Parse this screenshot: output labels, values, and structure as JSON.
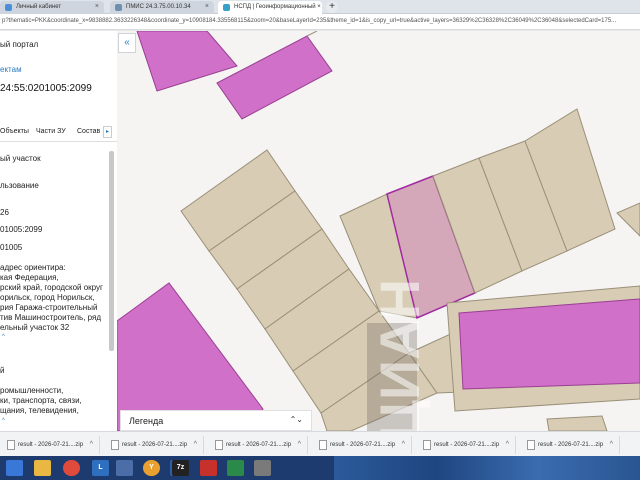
{
  "browser": {
    "tabs": [
      {
        "title": "Личный кабинет",
        "icon": "personal-cabinet-tab-icon",
        "color": "#4a90d9"
      },
      {
        "title": "ПМИС 24.3.75.00.10.34",
        "icon": "document-tab-icon",
        "color": "#6f8fb0"
      },
      {
        "title": "НСПД | Геоинформационный ×",
        "icon": "map-tab-icon",
        "color": "#38a0c8"
      }
    ],
    "new_tab_label": "+",
    "url": "p?thematic=PKK&coordinate_x=9838882.3633226348&coordinate_y=10908184.335568115&zoom=20&baseLayerId=235&theme_id=1&is_copy_url=true&active_layers=36329%2C36328%2C36049%2C36048&selectedCard=175..."
  },
  "left_panel": {
    "portal_title": "ый портал",
    "objects_link": "ектам",
    "cadastral_number": "24:55:0201005:2099",
    "tabs": [
      "Объекты",
      "Части ЗУ",
      "Состав"
    ],
    "tab_more_label": "▸",
    "lines": [
      "ый участок",
      "льзование",
      "26",
      "01005:2099",
      "01005",
      "адрес ориентира:",
      "кая Федерация,",
      "рский край, городской округ",
      "орильск, город Норильск,",
      "рия Гаража-строительный",
      "тив Машиностроитель, ряд",
      "ельный участок 32",
      "й",
      "ромышленности,",
      "ки, транспорта, связи,",
      "щания, телевидения,"
    ],
    "more_arrows": [
      "^",
      "^"
    ]
  },
  "map": {
    "collapse_label": "«",
    "legend_label": "Легенда",
    "legend_arrow": "⌃⌄",
    "watermark": "ЦИАН",
    "colors": {
      "background": "#f5f4f2",
      "parcel_fill": "#d8cdb4",
      "parcel_stroke": "#9a8f78",
      "building_fill": "#d070c8",
      "building_stroke": "#9a3f93",
      "selected_fill": "#d4a8b8",
      "selected_stroke": "#a02aa0"
    }
  },
  "downloads": {
    "items": [
      "result - 2026-07-21....zip",
      "result - 2026-07-21....zip",
      "result - 2026-07-21....zip",
      "result - 2026-07-21....zip",
      "result - 2026-07-21....zip",
      "result - 2026-07-21....zip"
    ]
  },
  "taskbar": {
    "icons": [
      {
        "name": "start-icon",
        "color": "#3a78d8",
        "label": ""
      },
      {
        "name": "explorer-icon",
        "color": "#e8b842",
        "label": ""
      },
      {
        "name": "chrome-icon",
        "color": "#e04a3c",
        "label": ""
      },
      {
        "name": "lync-icon",
        "color": "#2f6fbf",
        "label": "L"
      },
      {
        "name": "calculator-icon",
        "color": "#4b6ea8",
        "label": ""
      },
      {
        "name": "yandex-browser-icon",
        "color": "#e8a030",
        "label": "Y"
      },
      {
        "name": "mail-icon",
        "color": "#2f5fa8",
        "label": ""
      },
      {
        "name": "archiver-icon",
        "color": "#222222",
        "label": "7z"
      },
      {
        "name": "acrobat-icon",
        "color": "#c8302c",
        "label": ""
      },
      {
        "name": "excel-icon",
        "color": "#2a8a4a",
        "label": ""
      },
      {
        "name": "settings-icon",
        "color": "#7a7a7a",
        "label": ""
      }
    ]
  }
}
